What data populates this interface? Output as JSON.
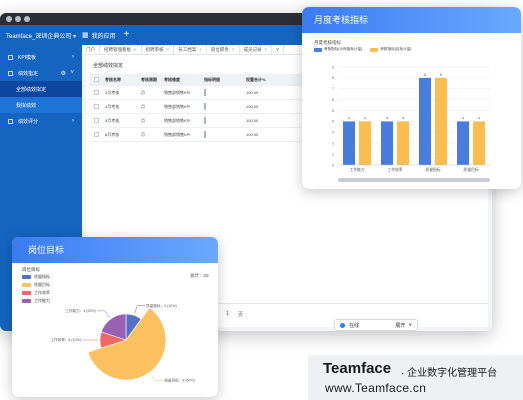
{
  "app": {
    "company": "Teamface_深圳企典公司",
    "company_arrow": "▾",
    "apps_label": "我的应用",
    "plus": "+"
  },
  "sidebar": {
    "items": [
      {
        "label": "KPI模板",
        "arrow": "›"
      },
      {
        "label": "绩效指定",
        "arrow": "˅"
      }
    ],
    "sub_items": [
      {
        "label": "全部绩效拟定"
      },
      {
        "label": "我拟绩效"
      }
    ],
    "last_item": {
      "label": "绩效评分",
      "arrow": "›"
    }
  },
  "tabs": [
    {
      "label": "门户"
    },
    {
      "label": "招聘管理看板"
    },
    {
      "label": "招聘审核"
    },
    {
      "label": "员工档案"
    },
    {
      "label": "岗位职责"
    },
    {
      "label": "成员记录"
    },
    {
      "label": "Y"
    }
  ],
  "panel": {
    "title": "全部绩效拟定"
  },
  "table": {
    "headers": [
      "考核名称",
      "考核周期",
      "考核维度",
      "指标明细",
      "权重合计%"
    ],
    "rows": [
      [
        "3月考核",
        "月",
        "销售部销售KPI",
        "",
        "100.00"
      ],
      [
        "4月考核",
        "月",
        "销售部销售KPI",
        "",
        "100.00"
      ],
      [
        "5月考核",
        "月",
        "销售部销售KPI",
        "",
        "100.00"
      ],
      [
        "6月考核",
        "月",
        "销售部销售KPI",
        "",
        "100.00"
      ]
    ]
  },
  "pagination": {
    "page": "1",
    "total": "页"
  },
  "online": {
    "label": "在线",
    "action": "展开",
    "arrow": "∨"
  },
  "month_card": {
    "title": "月度考核指标",
    "subtitle": "月度考核指标",
    "legend": [
      "考核指标(示例指标计量)",
      "考核指标(目标计量)"
    ],
    "colors": {
      "series1": "#4a7cde",
      "series2": "#fbbd4f"
    }
  },
  "chart_data": [
    {
      "type": "bar",
      "title": "月度考核指标",
      "categories": [
        "工作能力",
        "工作效率",
        "质量指标",
        "质量目标"
      ],
      "series": [
        {
          "name": "考核指标(示例指标计量)",
          "values": [
            4,
            4,
            8,
            4
          ]
        },
        {
          "name": "考核指标(目标计量)",
          "values": [
            4,
            4,
            8,
            4
          ]
        }
      ],
      "ylim": [
        0,
        9
      ],
      "yticks": [
        0,
        1,
        2,
        3,
        4,
        5,
        6,
        7,
        8,
        9
      ],
      "grid": true,
      "legend": "top-left"
    },
    {
      "type": "pie",
      "title": "岗位目标",
      "slices": [
        {
          "label": "质量指标",
          "value": 10,
          "color": "#5470c6",
          "text": "质量指标：4 (10%)"
        },
        {
          "label": "质量目标",
          "value": 60,
          "color": "#fbc160",
          "text": "质量目标：8 (60%)"
        },
        {
          "label": "工作效率",
          "value": 10,
          "color": "#ee6666",
          "text": "工作效率：4 (10%)"
        },
        {
          "label": "工作能力",
          "value": 20,
          "color": "#9a60b4",
          "text": "工作能力：4 (20%)"
        }
      ],
      "total_label": "总计：",
      "total_value": "20",
      "legend": "top-left"
    }
  ],
  "post_card": {
    "title": "岗位目标",
    "subtitle": "岗位目标",
    "total_label": "总计：20"
  },
  "brand": {
    "name": "Teamface",
    "tagline": "· 企业数字化管理平台",
    "url": "www.Teamface.cn"
  }
}
